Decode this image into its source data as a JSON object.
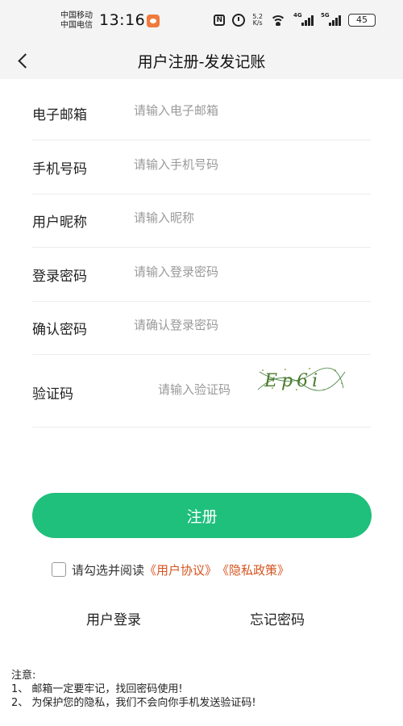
{
  "status_bar": {
    "carrier_1": "中国移动",
    "carrier_2": "中国电信",
    "time": "13:16",
    "nfc": "N",
    "speed_value": "5.2",
    "speed_unit": "K/s",
    "network_1": "4G",
    "network_2": "5G",
    "battery": "45"
  },
  "header": {
    "title": "用户注册-发发记账"
  },
  "form": {
    "email": {
      "label": "电子邮箱",
      "placeholder": "请输入电子邮箱",
      "value": ""
    },
    "phone": {
      "label": "手机号码",
      "placeholder": "请输入手机号码",
      "value": ""
    },
    "nickname": {
      "label": "用户昵称",
      "placeholder": "请输入昵称",
      "value": ""
    },
    "password": {
      "label": "登录密码",
      "placeholder": "请输入登录密码",
      "value": ""
    },
    "confirm": {
      "label": "确认密码",
      "placeholder": "请确认登录密码",
      "value": ""
    },
    "captcha": {
      "label": "验证码",
      "placeholder": "请输入验证码",
      "value": "",
      "image_text": "Ep6i"
    }
  },
  "register_button": "注册",
  "agreement": {
    "text": "请勾选并阅读",
    "user_agreement": "《用户协议》",
    "privacy_policy": "《隐私政策》",
    "checked": false
  },
  "links": {
    "login": "用户登录",
    "forgot": "忘记密码"
  },
  "notes": {
    "title": "注意:",
    "line1": "1、 邮箱一定要牢记，找回密码使用!",
    "line2": "2、 为保护您的隐私，我们不会向你手机发送验证码!"
  },
  "colors": {
    "accent": "#1fbf7c",
    "link": "#d5541f",
    "header_bg": "#f4f4f4"
  }
}
